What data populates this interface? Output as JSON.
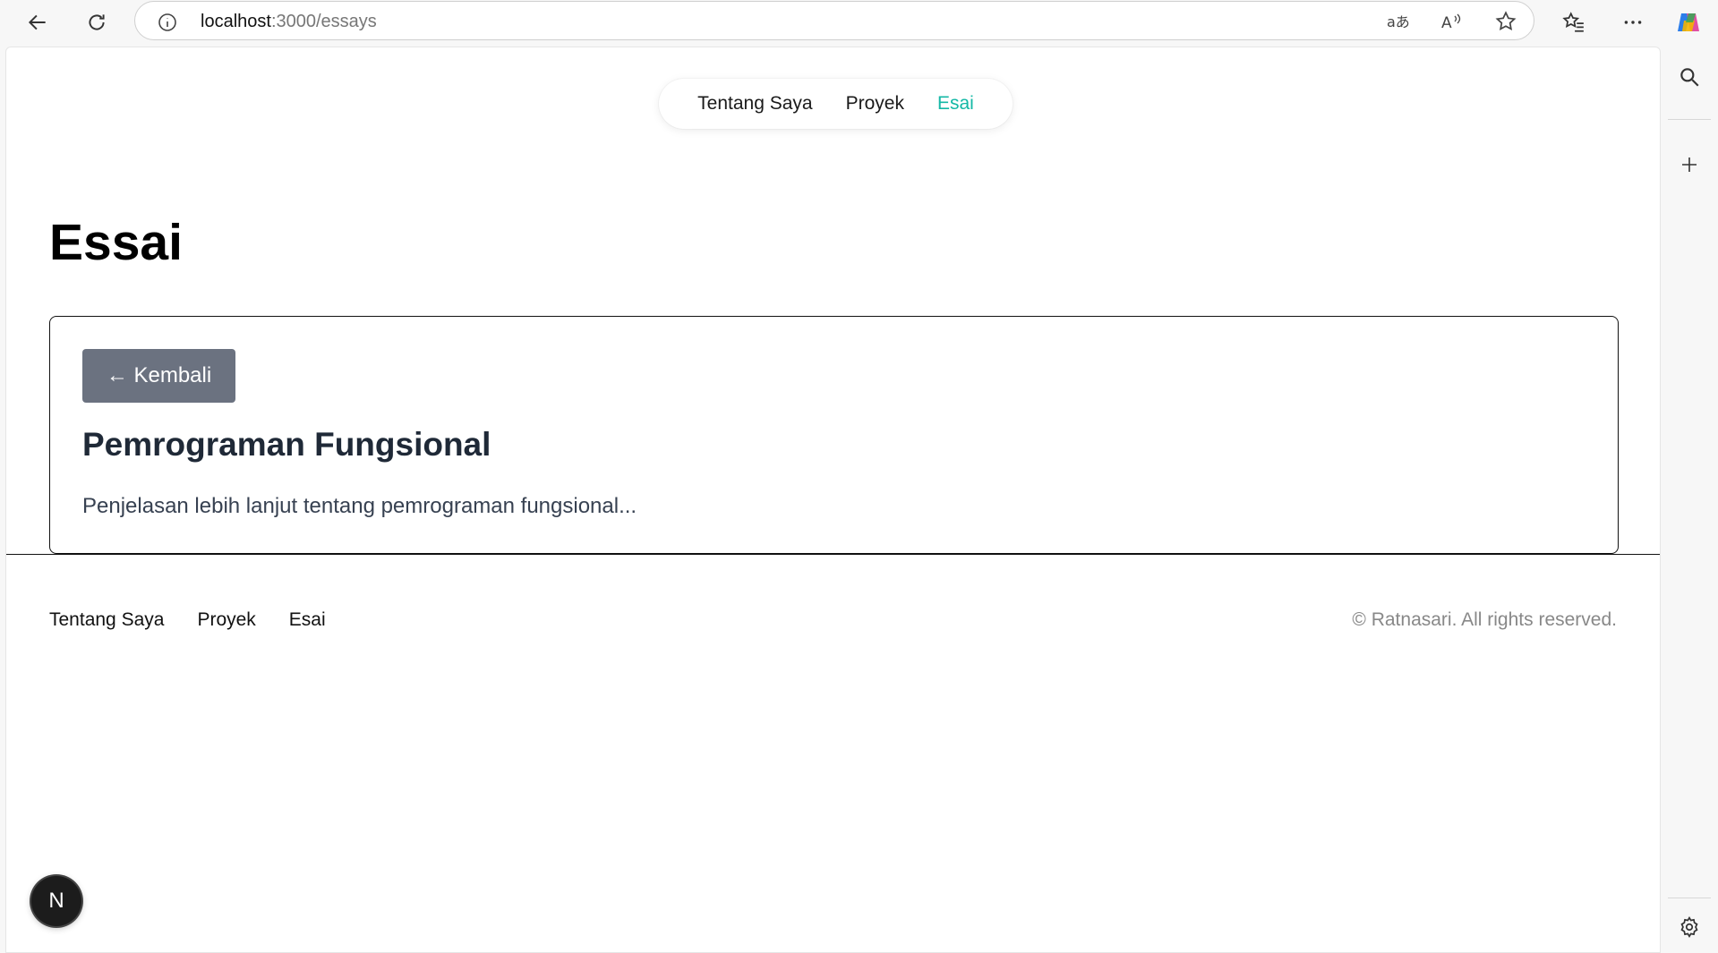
{
  "browser": {
    "url_host": "localhost",
    "url_path": ":3000/essays",
    "icons": [
      "back-icon",
      "reload-icon",
      "site-info-icon",
      "translate-icon",
      "read-aloud-icon",
      "favorite-star-icon",
      "favorites-icon",
      "more-icon",
      "copilot-icon",
      "search-icon",
      "add-icon",
      "settings-icon"
    ]
  },
  "nav": {
    "items": [
      "Tentang Saya",
      "Proyek",
      "Esai"
    ],
    "active": "Esai",
    "active_color": "#14b8a6"
  },
  "page": {
    "title": "Essai"
  },
  "card": {
    "back_label": "← Kembali",
    "title": "Pemrograman Fungsional",
    "body": "Penjelasan lebih lanjut tentang pemrograman fungsional..."
  },
  "footer": {
    "items": [
      "Tentang Saya",
      "Proyek",
      "Esai"
    ],
    "copyright": "© Ratnasari. All rights reserved."
  },
  "dev_badge": {
    "label": "N"
  },
  "colors": {
    "back_button_bg": "#6b7280",
    "heading": "#1f2937",
    "muted": "#888888"
  }
}
